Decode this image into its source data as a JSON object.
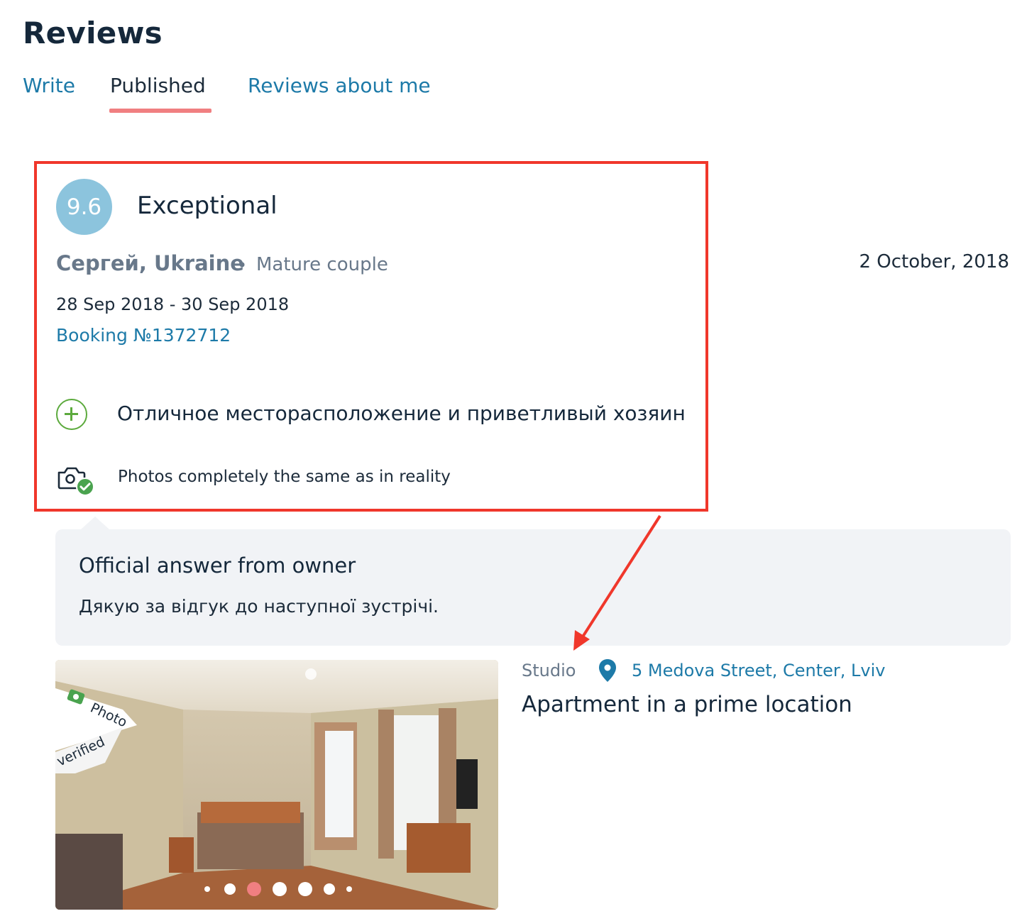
{
  "page": {
    "title": "Reviews"
  },
  "tabs": [
    {
      "label": "Write",
      "active": false
    },
    {
      "label": "Published",
      "active": true
    },
    {
      "label": "Reviews about me",
      "active": false
    }
  ],
  "review": {
    "score": "9.6",
    "score_label": "Exceptional",
    "author": "Сергей, Ukraine",
    "separator": "•",
    "guest_type": "Mature couple",
    "date": "2 October, 2018",
    "stay_dates": "28 Sep 2018 - 30 Sep 2018",
    "booking": "Booking №1372712",
    "positive": "Отличное месторасположение и приветливый хозяин",
    "photo_note": "Photos completely the same as in reality"
  },
  "owner_answer": {
    "title": "Official answer from owner",
    "text": "Дякую за відгук до наступної зустрічі."
  },
  "property": {
    "type": "Studio",
    "address": "5 Medova Street, Center, Lviv",
    "name": "Apartment in a prime location",
    "badge_line1": "Photo",
    "badge_line2": "verified",
    "carousel_active_index": 2,
    "carousel_count": 7
  },
  "colors": {
    "accent_link": "#1d7aa8",
    "tab_underline": "#f07f81",
    "score_bg": "#8cc4dd",
    "positive_green": "#5caa3d",
    "annotation_red": "#f0372b",
    "answer_bg": "#f1f3f6"
  },
  "icons": [
    "plus-icon",
    "camera-check-icon",
    "location-pin-icon",
    "photo-camera-icon"
  ]
}
